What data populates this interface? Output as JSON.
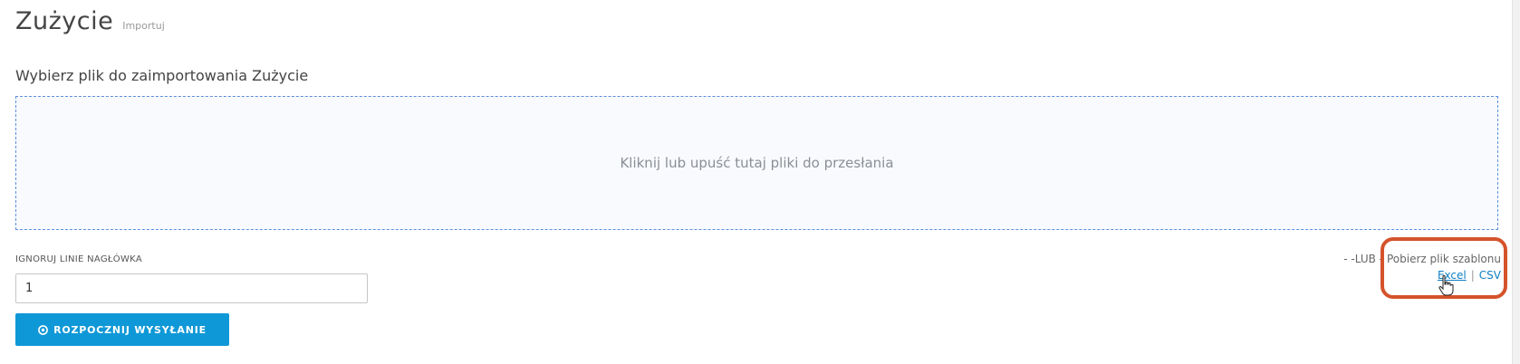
{
  "header": {
    "title": "Zużycie",
    "subtitle": "Importuj"
  },
  "import": {
    "heading": "Wybierz plik do zaimportowania Zużycie",
    "dropzone_text": "Kliknij lub upuść tutaj pliki do przesłania",
    "ignore_header_label": "IGNORUJ LINIE NAGŁÓWKA",
    "ignore_header_value": "1",
    "start_button_label": "ROZPOCZNIJ WYSYŁANIE",
    "or_text": "- -LUB -",
    "template_text": "Pobierz plik szablonu",
    "excel_link": "Excel",
    "separator": "|",
    "csv_link": "CSV"
  },
  "colors": {
    "accent": "#0f98d7",
    "link": "#0f7fc4",
    "highlight": "#d4532b",
    "dropzone_border": "#5a8fdc"
  },
  "icons": {
    "start_button_icon": "circle-arrow-icon",
    "cursor_icon": "hand-pointer-icon"
  }
}
